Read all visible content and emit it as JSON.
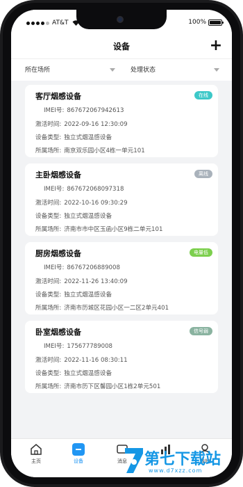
{
  "status_bar": {
    "carrier": "AT&T",
    "battery": "100%",
    "battery_level": 1.0
  },
  "navbar": {
    "title": "设备",
    "add_symbol": "+"
  },
  "filters": {
    "location": "所在场所",
    "status": "处理状态"
  },
  "labels": {
    "imei": "IMEI号:",
    "activated": "激活时间:",
    "type": "设备类型:",
    "location": "所属场所:"
  },
  "devices": [
    {
      "name": "客厅烟感设备",
      "badge": "在线",
      "badge_color": "#3cc8c8",
      "imei": "867672067942613",
      "activated": "2022-09-16  12:30:09",
      "type": "独立式烟温感设备",
      "location": "南京双乐园小区4栋一单元101"
    },
    {
      "name": "主卧烟感设备",
      "badge": "离线",
      "badge_color": "#a9b2bb",
      "imei": "867672068097318",
      "activated": "2022-10-16  09:30:29",
      "type": "独立式烟温感设备",
      "location": "济南市市中区玉函小区9栋二单元101"
    },
    {
      "name": "厨房烟感设备",
      "badge": "电量低",
      "badge_color": "#7ccf4d",
      "imei": "86767206889008",
      "activated": "2022-11-26  13:40:09",
      "type": "独立式烟温感设备",
      "location": "济南市历城区花园小区一二区2单元401"
    },
    {
      "name": "卧室烟感设备",
      "badge": "信号弱",
      "badge_color": "#8ab3a0",
      "imei": "175677789008",
      "activated": "2022-11-16  08:30:11",
      "type": "独立式烟温感设备",
      "location": "济南市历下区馨园小区1栋2单元501"
    }
  ],
  "tabbar": {
    "home": "主页",
    "devices": "设备",
    "alerts": "消息",
    "mine": "我的"
  },
  "icons": {
    "home": "home-icon",
    "devices": "device-icon",
    "alerts": "message-icon",
    "stats": "chart-icon",
    "mine": "user-icon"
  },
  "watermark": {
    "text": "第七下载站",
    "url": "www.d7xzz.com"
  }
}
